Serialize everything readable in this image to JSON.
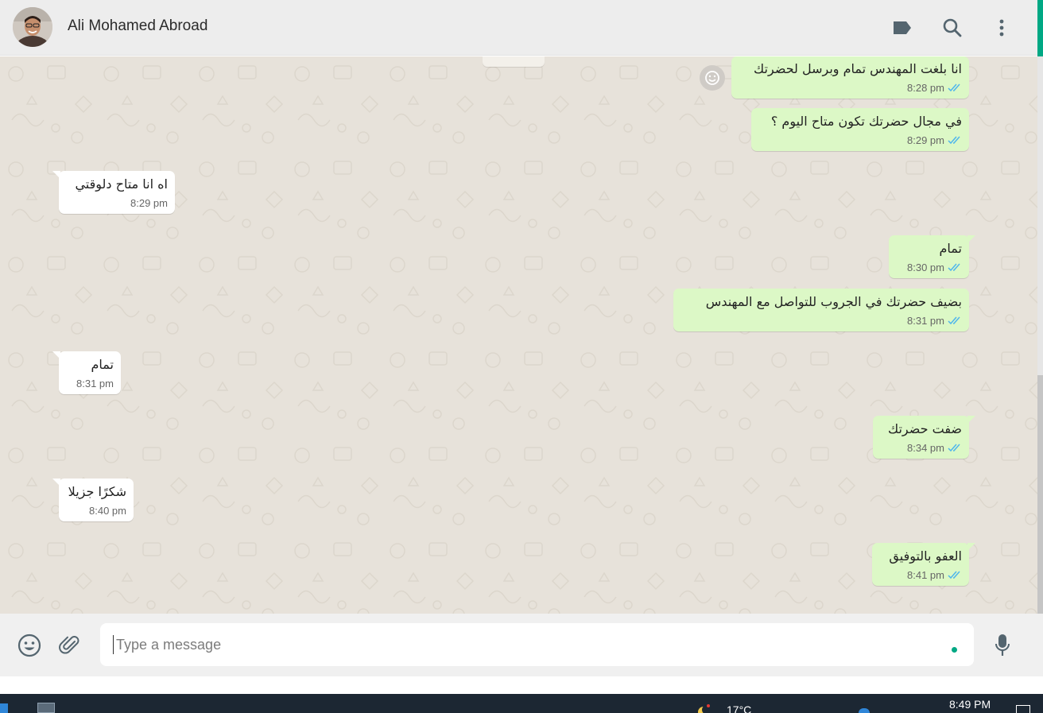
{
  "header": {
    "contact_name": "Ali Mohamed Abroad",
    "icons": [
      "label-icon",
      "search-icon",
      "more-vertical-icon"
    ]
  },
  "messages": [
    {
      "direction": "out",
      "text": "انا بلغت المهندس تمام وبرسل لحضرتك",
      "time": "8:28 pm",
      "status": "read"
    },
    {
      "direction": "out",
      "text": "في مجال حضرتك تكون متاح اليوم ؟",
      "time": "8:29 pm",
      "status": "read"
    },
    {
      "direction": "in",
      "text": "اه انا متاح دلوقتي",
      "time": "8:29 pm"
    },
    {
      "direction": "out",
      "text": "تمام",
      "time": "8:30 pm",
      "status": "read"
    },
    {
      "direction": "out",
      "text": "بضيف حضرتك في الجروب للتواصل مع المهندس",
      "time": "8:31 pm",
      "status": "read"
    },
    {
      "direction": "in",
      "text": "تمام",
      "time": "8:31 pm"
    },
    {
      "direction": "out",
      "text": "ضفت حضرتك",
      "time": "8:34 pm",
      "status": "read"
    },
    {
      "direction": "in",
      "text": "شكرًا جزيلا",
      "time": "8:40 pm"
    },
    {
      "direction": "out",
      "text": "العفو بالتوفيق",
      "time": "8:41 pm",
      "status": "read"
    }
  ],
  "composer": {
    "placeholder": "Type a message",
    "icons": [
      "emoji-icon",
      "attach-icon",
      "microphone-icon"
    ]
  },
  "taskbar": {
    "clock": "8:49 PM",
    "weather": "17°C"
  },
  "colors": {
    "outgoing_bubble": "#dcf8c6",
    "incoming_bubble": "#ffffff",
    "chat_background": "#e7e2da",
    "read_ticks": "#4fb6ec",
    "accent": "#00a884",
    "header_bg": "#ededed"
  }
}
